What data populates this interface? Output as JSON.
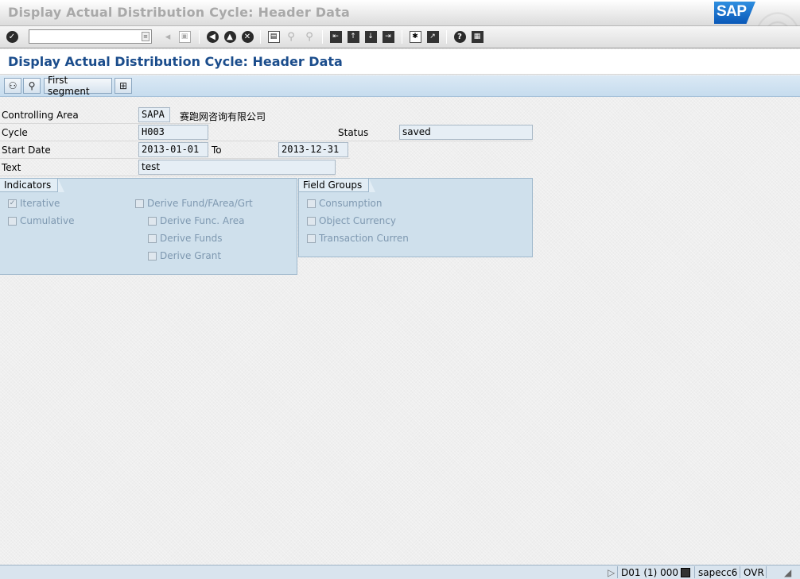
{
  "window": {
    "title": "Display Actual Distribution Cycle: Header Data",
    "logo": "SAP"
  },
  "toolbar": {
    "command_field_value": "",
    "icons": [
      "enter-icon",
      "dropdown-icon",
      "back-arrow-icon",
      "save-icon",
      "back-icon",
      "exit-icon",
      "cancel-icon",
      "print-icon",
      "find-icon",
      "find-next-icon",
      "first-page-icon",
      "previous-page-icon",
      "next-page-icon",
      "last-page-icon",
      "create-session-icon",
      "shortcut-icon",
      "help-icon",
      "customize-layout-icon"
    ]
  },
  "page": {
    "title": "Display Actual Distribution Cycle: Header Data"
  },
  "app_toolbar": {
    "first_segment_label": "First segment"
  },
  "form": {
    "controlling_area": {
      "label": "Controlling Area",
      "value": "SAPA",
      "description": "赛跑网咨询有限公司"
    },
    "cycle": {
      "label": "Cycle",
      "value": "H003"
    },
    "status": {
      "label": "Status",
      "value": "saved"
    },
    "start_date": {
      "label": "Start Date",
      "value": "2013-01-01"
    },
    "to": {
      "label": "To",
      "value": "2013-12-31"
    },
    "text": {
      "label": "Text",
      "value": "test"
    }
  },
  "indicators": {
    "title": "Indicators",
    "items": [
      {
        "label": "Iterative",
        "checked": true
      },
      {
        "label": "Cumulative",
        "checked": false
      },
      {
        "label": "Derive Fund/FArea/Grt",
        "checked": false
      },
      {
        "label": "Derive Func. Area",
        "checked": false
      },
      {
        "label": "Derive Funds",
        "checked": false
      },
      {
        "label": "Derive Grant",
        "checked": false
      }
    ]
  },
  "field_groups": {
    "title": "Field Groups",
    "items": [
      {
        "label": "Consumption",
        "checked": false
      },
      {
        "label": "Object Currency",
        "checked": false
      },
      {
        "label": "Transaction Curren",
        "checked": false
      }
    ]
  },
  "statusbar": {
    "system": "D01 (1) 000",
    "server": "sapecc6",
    "mode": "OVR"
  }
}
